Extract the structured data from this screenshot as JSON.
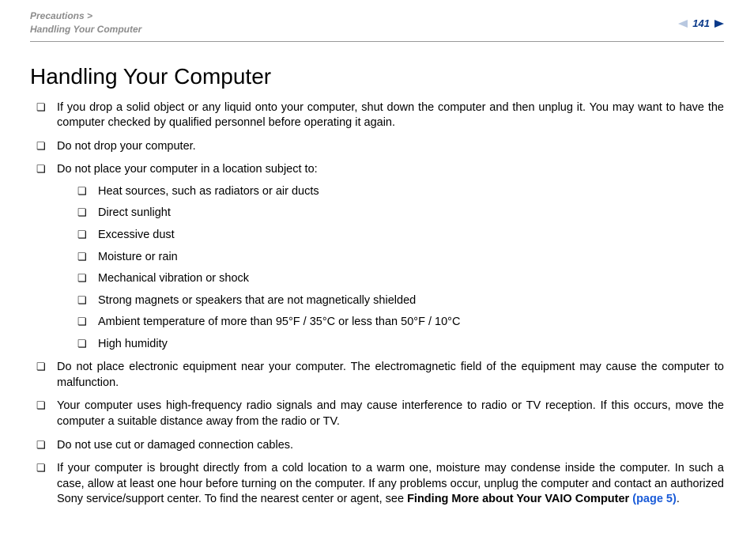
{
  "header": {
    "breadcrumb_part1": "Precautions >",
    "breadcrumb_part2": "Handling Your Computer",
    "page_number": "141"
  },
  "title": "Handling Your Computer",
  "items": [
    "If you drop a solid object or any liquid onto your computer, shut down the computer and then unplug it. You may want to have the computer checked by qualified personnel before operating it again.",
    "Do not drop your computer.",
    "Do not place your computer in a location subject to:"
  ],
  "sub_items": [
    "Heat sources, such as radiators or air ducts",
    "Direct sunlight",
    "Excessive dust",
    "Moisture or rain",
    "Mechanical vibration or shock",
    "Strong magnets or speakers that are not magnetically shielded",
    "Ambient temperature of more than 95°F / 35°C or less than 50°F / 10°C",
    "High humidity"
  ],
  "items2": [
    "Do not place electronic equipment near your computer. The electromagnetic field of the equipment may cause the computer to malfunction.",
    "Your computer uses high-frequency radio signals and may cause interference to radio or TV reception. If this occurs, move the computer a suitable distance away from the radio or TV.",
    "Do not use cut or damaged connection cables."
  ],
  "last_item": {
    "text_a": "If your computer is brought directly from a cold location to a warm one, moisture may condense inside the computer. In such a case, allow at least one hour before turning on the computer. If any problems occur, unplug the computer and contact an authorized Sony service/support center. To find the nearest center or agent, see ",
    "bold_a": "Finding More about Your VAIO Computer ",
    "link": "(page 5)",
    "text_b": "."
  }
}
